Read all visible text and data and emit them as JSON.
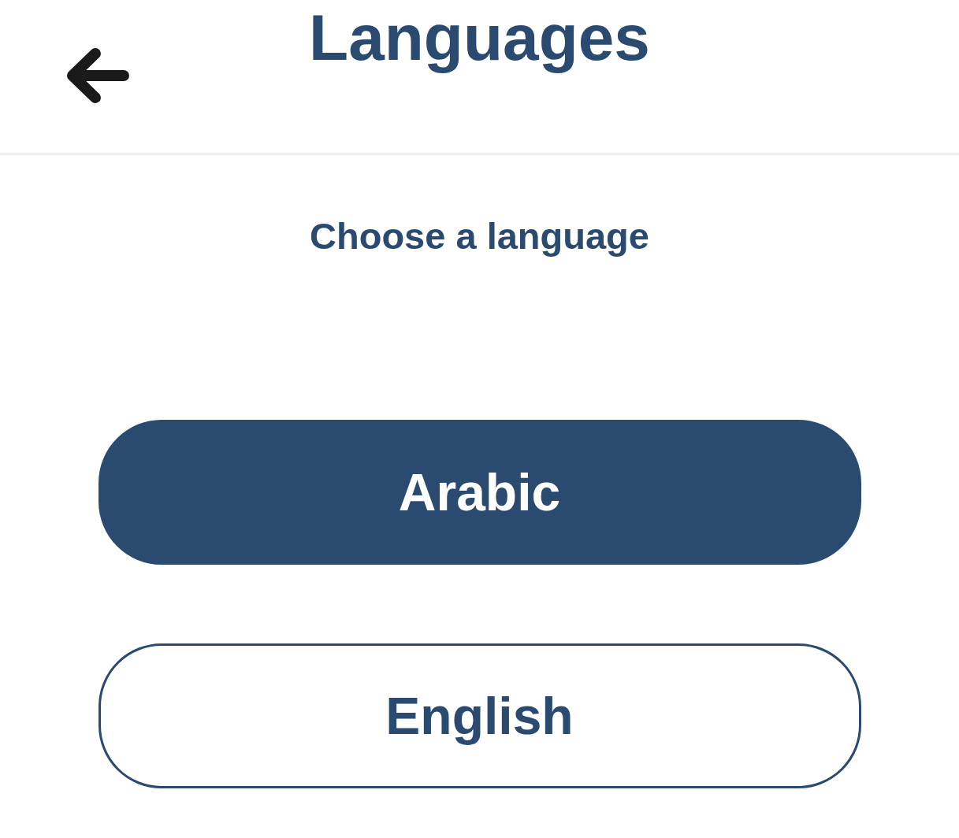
{
  "header": {
    "title": "Languages"
  },
  "prompt": "Choose a language",
  "options": [
    {
      "label": "Arabic",
      "selected": true
    },
    {
      "label": "English",
      "selected": false
    }
  ]
}
